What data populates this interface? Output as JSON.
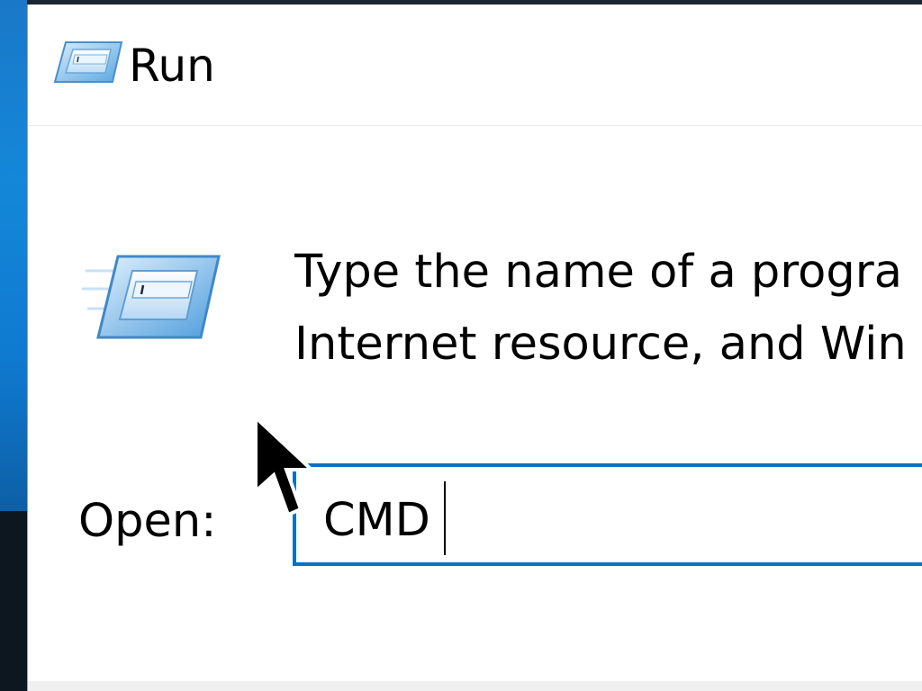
{
  "window": {
    "title": "Run",
    "title_icon": "run-icon"
  },
  "dialog": {
    "icon": "run-icon",
    "description_lines": [
      "Type the name of a progra",
      "Internet resource, and Win"
    ]
  },
  "open_field": {
    "label": "Open:",
    "value": "CMD"
  },
  "colors": {
    "input_border": "#0c70c4",
    "desktop_blue": "#1487d8"
  },
  "pointer": "arrow-cursor-icon"
}
